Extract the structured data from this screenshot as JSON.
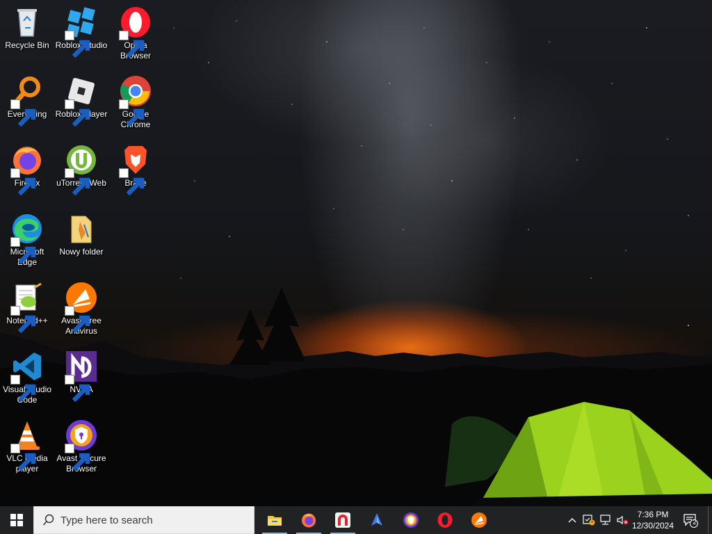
{
  "desktop": {
    "icons": [
      {
        "label": "Recycle Bin",
        "icon": "recycle-bin-icon"
      },
      {
        "label": "Roblox Studio",
        "icon": "roblox-studio-icon"
      },
      {
        "label": "Opera Browser",
        "icon": "opera-icon"
      },
      {
        "label": "Everything",
        "icon": "everything-search-icon"
      },
      {
        "label": "Roblox Player",
        "icon": "roblox-player-icon"
      },
      {
        "label": "Google Chrome",
        "icon": "chrome-icon"
      },
      {
        "label": "Firefox",
        "icon": "firefox-icon"
      },
      {
        "label": "uTorrent Web",
        "icon": "utorrent-icon"
      },
      {
        "label": "Brave",
        "icon": "brave-icon"
      },
      {
        "label": "Microsoft Edge",
        "icon": "edge-icon"
      },
      {
        "label": "Nowy folder",
        "icon": "folder-icon"
      },
      {
        "label": "Notepad++",
        "icon": "notepadpp-icon"
      },
      {
        "label": "Avast Free Antivirus",
        "icon": "avast-icon"
      },
      {
        "label": "Visual Studio Code",
        "icon": "vscode-icon"
      },
      {
        "label": "NVDA",
        "icon": "nvda-icon"
      },
      {
        "label": "VLC media player",
        "icon": "vlc-icon"
      },
      {
        "label": "Avast Secure Browser",
        "icon": "avast-secure-browser-icon"
      }
    ]
  },
  "taskbar": {
    "search_placeholder": "Type here to search",
    "pinned": [
      {
        "name": "File Explorer",
        "icon": "file-explorer-icon",
        "running": true
      },
      {
        "name": "Firefox",
        "icon": "firefox-icon",
        "running": true
      },
      {
        "name": "Unknown app",
        "icon": "red-arch-app-icon",
        "running": true
      },
      {
        "name": "Unknown app",
        "icon": "blue-app-icon",
        "running": false
      },
      {
        "name": "Avast Secure Browser",
        "icon": "avast-secure-browser-icon",
        "running": false
      },
      {
        "name": "Opera",
        "icon": "opera-icon",
        "running": false
      },
      {
        "name": "Avast",
        "icon": "avast-icon",
        "running": false
      }
    ],
    "clock": {
      "time": "7:36 PM",
      "date": "12/30/2024"
    },
    "notifications_count": "2"
  },
  "colors": {
    "taskbar_bg": "#202224",
    "search_bg": "#f0f0f0",
    "tent_green": "#8fd11c",
    "horizon_orange": "#ff7a14"
  }
}
